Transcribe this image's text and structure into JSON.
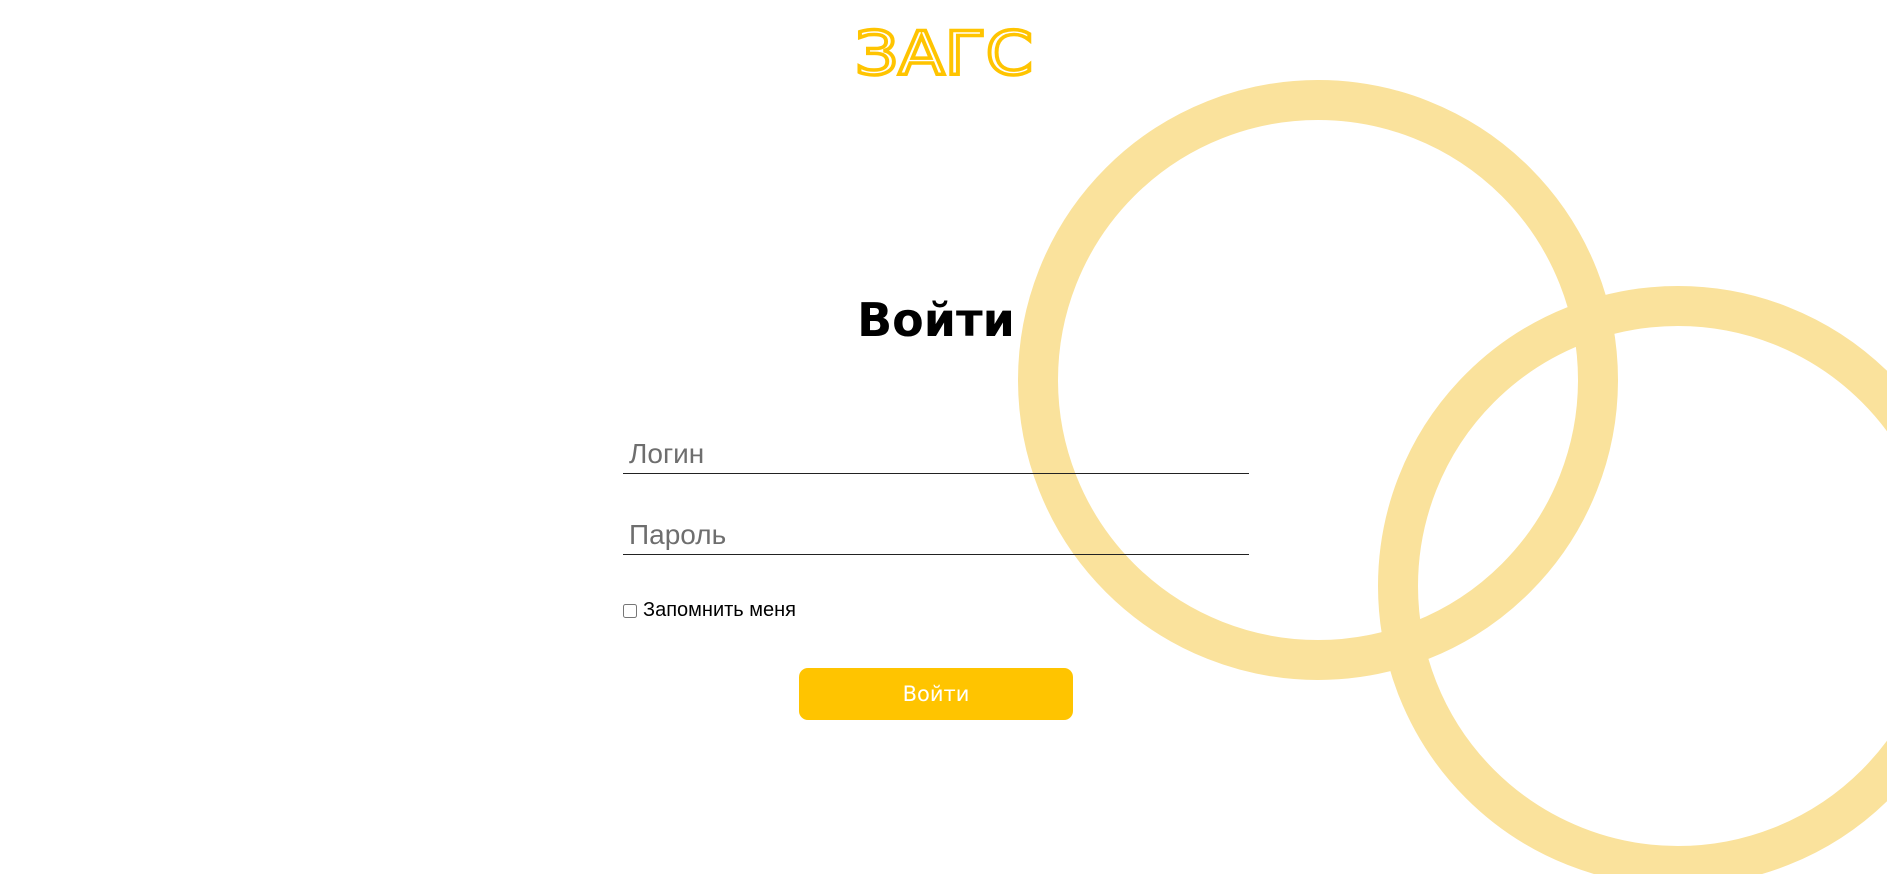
{
  "brand": {
    "logo_text": "ЗАГС",
    "color": "#ffc400",
    "ring_color": "#fae29c"
  },
  "login_form": {
    "title": "Войти",
    "login_placeholder": "Логин",
    "password_placeholder": "Пароль",
    "remember_label": "Запомнить меня",
    "submit_label": "Войти"
  }
}
